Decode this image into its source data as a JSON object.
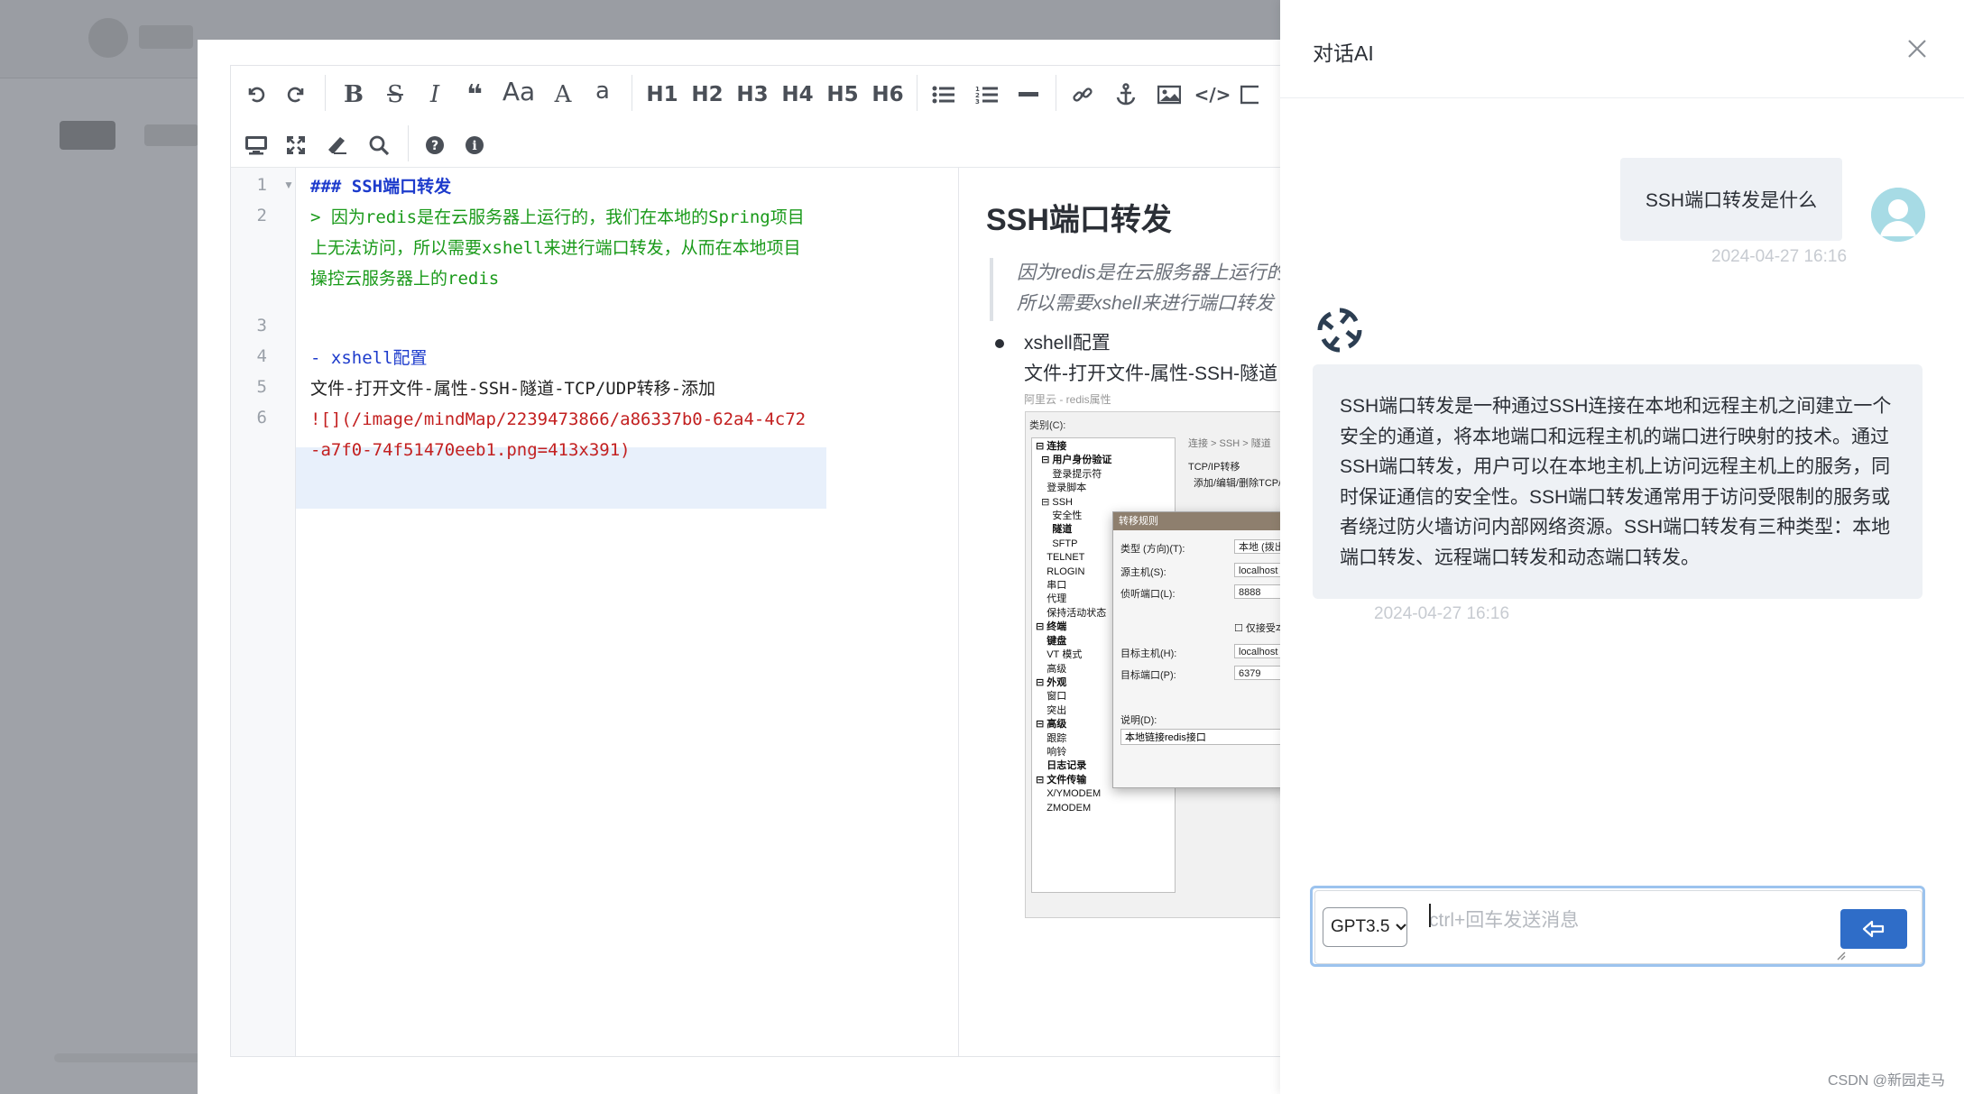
{
  "drawer": {
    "title": "对话AI",
    "user_message": "SSH端口转发是什么",
    "user_time": "2024-04-27 16:16",
    "ai_message": "SSH端口转发是一种通过SSH连接在本地和远程主机之间建立一个安全的通道，将本地端口和远程主机的端口进行映射的技术。通过SSH端口转发，用户可以在本地主机上访问远程主机上的服务，同时保证通信的安全性。SSH端口转发通常用于访问受限制的服务或者绕过防火墙访问内部网络资源。SSH端口转发有三种类型：本地端口转发、远程端口转发和动态端口转发。",
    "ai_time": "2024-04-27 16:16",
    "model": "GPT3.5",
    "input_placeholder": "ctrl+回车发送消息",
    "input_value": ""
  },
  "toolbar": {
    "row1": [
      "↶",
      "↷",
      "B",
      "S",
      "I",
      "❝",
      "Aa",
      "A",
      "a",
      "H1",
      "H2",
      "H3",
      "H4",
      "H5",
      "H6"
    ],
    "h1": "H1",
    "h2": "H2",
    "h3": "H3",
    "h4": "H4",
    "h5": "H5",
    "h6": "H6",
    "aa": "Aa"
  },
  "code": {
    "line_numbers": [
      "1",
      "2",
      "3",
      "4",
      "5",
      "6"
    ],
    "l1": "### SSH端口转发",
    "l2": "> 因为redis是在云服务器上运行的，我们在本地的Spring项目上无法访问，所以需要xshell来进行端口转发，从而在本地项目操控云服务器上的redis",
    "l4": "- xshell配置",
    "l5": "文件-打开文件-属性-SSH-隧道-TCP/UDP转移-添加",
    "l6a": "![]",
    "l6b": "(/image/mindMap/2239473866/a86337b0-62a4-4c72-a7f0-74f51470eeb1.png=413x391)"
  },
  "preview": {
    "heading": "SSH端口转发",
    "quote_line1": "因为redis是在云服务器上运行的",
    "quote_line2": "所以需要xshell来进行端口转发",
    "li1": "xshell配置",
    "li2": "文件-打开文件-属性-SSH-隧道",
    "img_caption": "阿里云 - redis属性",
    "img": {
      "top_label": "类别(C):",
      "crumb": "连接 > SSH > 隧道",
      "tcp": "TCP/IP转移",
      "tcp_action": "添加/编辑/删除TCP/",
      "tree": [
        "⊟ 连接",
        "  ⊟ 用户身份验证",
        "      登录提示符",
        "    登录脚本",
        "  ⊟ SSH",
        "      安全性",
        "      隧道",
        "      SFTP",
        "    TELNET",
        "    RLOGIN",
        "    串口",
        "    代理",
        "    保持活动状态",
        "⊟ 终端",
        "    键盘",
        "    VT 模式",
        "    高级",
        "⊟ 外观",
        "    窗口",
        "    突出",
        "⊟ 高级",
        "    跟踪",
        "    响铃",
        "    日志记录",
        "⊟ 文件传输",
        "    X/YMODEM",
        "    ZMODEM"
      ],
      "dialog_title": "转移规则",
      "type_label": "类型 (方向)(T):",
      "type_value": "本地 (拨出)",
      "src_host_label": "源主机(S):",
      "src_host_value": "localhost",
      "listen_port_label": "侦听端口(L):",
      "listen_port_value": "8888",
      "accept_local": "仅接受本",
      "target_host_label": "目标主机(H):",
      "target_host_value": "localhost",
      "target_port_label": "目标端口(P):",
      "target_port_value": "6379",
      "desc_label": "说明(D):",
      "desc_value": "本地链接redis接口"
    }
  },
  "watermark": "CSDN @新园走马",
  "colors": {
    "accent": "#2f6dc8",
    "code_heading": "#1d3bcc",
    "code_quote": "#1a9a1a",
    "code_link": "#c32020"
  }
}
